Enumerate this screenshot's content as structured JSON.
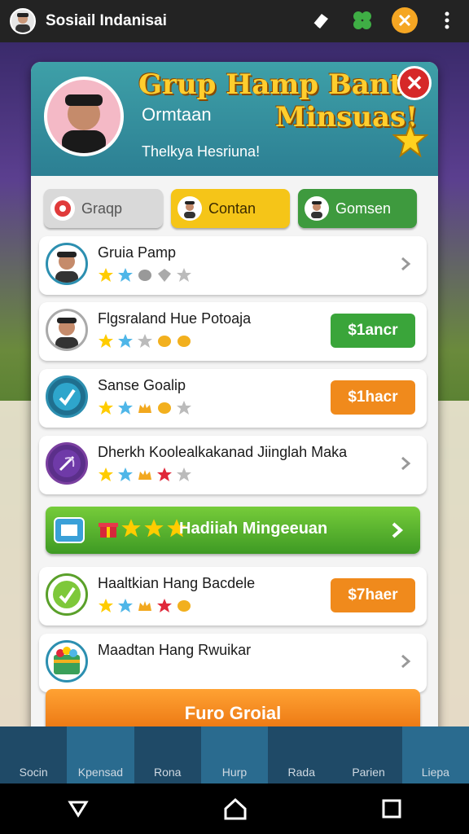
{
  "app": {
    "title": "Sosiail Indanisai"
  },
  "modal": {
    "title_line1": "Grup Hamp Bant",
    "title_line2": "Minsuas!",
    "subtitle": "Ormtaan",
    "tagline": "Thelkya Hesriuna!",
    "close_label": "✕"
  },
  "tabs": [
    {
      "label": "Graqp"
    },
    {
      "label": "Contan"
    },
    {
      "label": "Gomsen"
    }
  ],
  "rows": [
    {
      "name": "Gruia Pamp",
      "action": ""
    },
    {
      "name": "Flgsraland Hue Potoaja",
      "action": "$1ancr"
    },
    {
      "name": "Sanse Goalip",
      "action": "$1hacr"
    },
    {
      "name": "Dherkh Koolealkakanad Jiinglah Maka",
      "action": ""
    },
    {
      "name": "Haaltkian Hang Bacdele",
      "action": "$7haer"
    },
    {
      "name": "Maadtan Hang Rwuikar",
      "action": ""
    }
  ],
  "banner": {
    "label": "Hadiiah Mingeeuan"
  },
  "cta": {
    "label": "Furo Groial"
  },
  "bottom_nav": [
    "Socin",
    "Kpensad",
    "Rona",
    "Hurp",
    "Rada",
    "Parien",
    "Liepa"
  ],
  "colors": {
    "accent": "#f08a1c",
    "brand_green": "#3aa53a",
    "header_teal": "#2c7f93"
  }
}
